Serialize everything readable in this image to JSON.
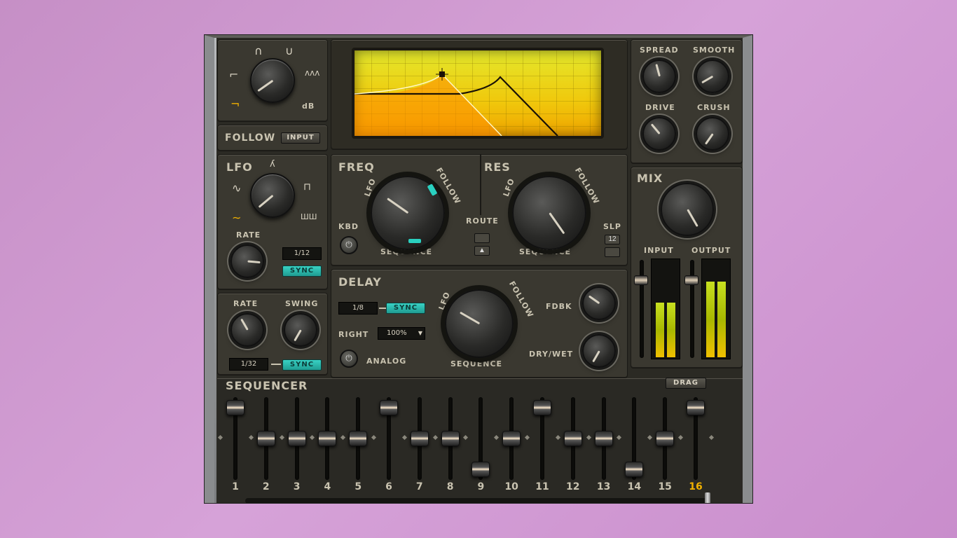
{
  "filter": {
    "db_label": "dB",
    "follow_label": "FOLLOW",
    "input_button": "INPUT"
  },
  "lfo": {
    "title": "LFO",
    "rate_label": "RATE",
    "rate_value": "1/12",
    "sync_button": "SYNC"
  },
  "sequencer_rate": {
    "rate_label": "RATE",
    "swing_label": "SWING",
    "rate_value": "1/32",
    "sync_button": "SYNC"
  },
  "freq": {
    "title": "FREQ",
    "lfo_label": "LFO",
    "follow_label": "FOLLOW",
    "sequence_label": "SEQUENCE",
    "kbd_label": "KBD"
  },
  "route": {
    "label": "ROUTE"
  },
  "res": {
    "title": "RES",
    "lfo_label": "LFO",
    "follow_label": "FOLLOW",
    "sequence_label": "SEQUENCE",
    "slp_label": "SLP",
    "slp_value": "12"
  },
  "delay": {
    "title": "DELAY",
    "time_value": "1/8",
    "sync_button": "SYNC",
    "right_label": "RIGHT",
    "right_value": "100%",
    "analog_label": "ANALOG",
    "lfo_label": "LFO",
    "follow_label": "FOLLOW",
    "sequence_label": "SEQUENCE",
    "fdbk_label": "FDBK",
    "drywet_label": "DRY/WET"
  },
  "distort": {
    "spread_label": "SPREAD",
    "smooth_label": "SMOOTH",
    "drive_label": "DRIVE",
    "crush_label": "CRUSH"
  },
  "mix": {
    "title": "MIX",
    "input_label": "INPUT",
    "output_label": "OUTPUT"
  },
  "sequencer": {
    "title": "SEQUENCER",
    "drag_button": "DRAG",
    "steps": [
      "1",
      "2",
      "3",
      "4",
      "5",
      "6",
      "7",
      "8",
      "9",
      "10",
      "11",
      "12",
      "13",
      "14",
      "15",
      "16"
    ],
    "active_step": "16"
  }
}
